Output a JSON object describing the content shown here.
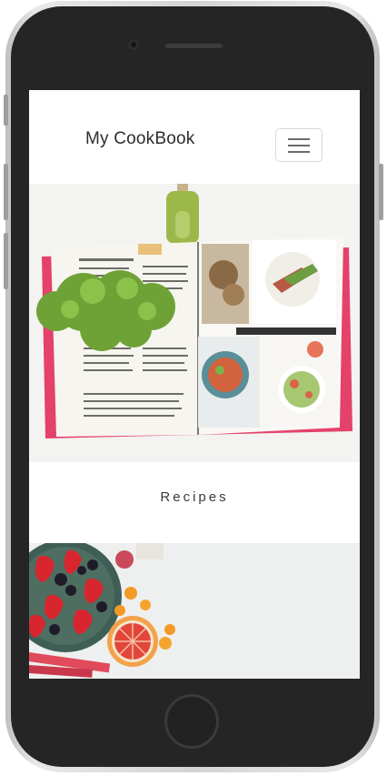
{
  "app": {
    "brand": "My CookBook"
  },
  "navbar": {
    "toggle_icon": "hamburger-menu-icon"
  },
  "cards": [
    {
      "caption": "Recipes",
      "image": "open-cookbook-photo"
    },
    {
      "image": "fruit-bowl-photo"
    }
  ],
  "colors": {
    "screen_bg": "#ffffff",
    "text": "#2d2d2d",
    "device": "#252525"
  }
}
